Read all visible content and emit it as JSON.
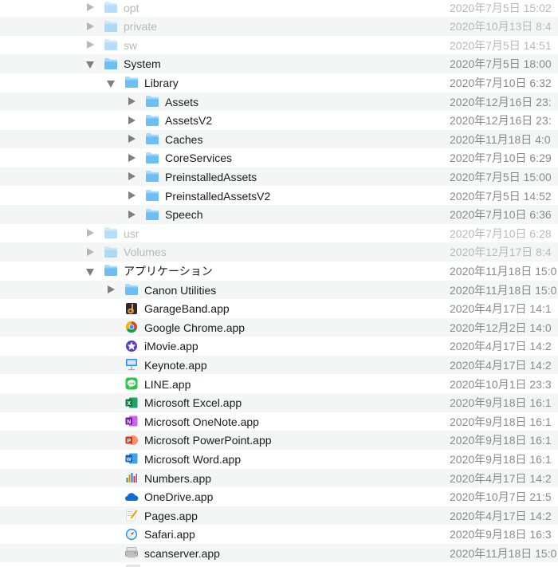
{
  "rows": [
    {
      "name": "opt",
      "date": "2020年7月5日 15:02",
      "level": 0,
      "disclosure": "closed",
      "icon": "folder-icon",
      "dim": true
    },
    {
      "name": "private",
      "date": "2020年10月13日 8:4",
      "level": 0,
      "disclosure": "closed",
      "icon": "folder-icon",
      "dim": true
    },
    {
      "name": "sw",
      "date": "2020年7月5日 14:51",
      "level": 0,
      "disclosure": "closed",
      "icon": "folder-icon",
      "dim": true
    },
    {
      "name": "System",
      "date": "2020年7月5日 18:00",
      "level": 0,
      "disclosure": "open",
      "icon": "folder-icon",
      "dim": false
    },
    {
      "name": "Library",
      "date": "2020年7月10日 6:32",
      "level": 1,
      "disclosure": "open",
      "icon": "folder-icon",
      "dim": false
    },
    {
      "name": "Assets",
      "date": "2020年12月16日 23:",
      "level": 2,
      "disclosure": "closed",
      "icon": "folder-icon",
      "dim": false
    },
    {
      "name": "AssetsV2",
      "date": "2020年12月16日 23:",
      "level": 2,
      "disclosure": "closed",
      "icon": "folder-icon",
      "dim": false
    },
    {
      "name": "Caches",
      "date": "2020年11月18日 4:0",
      "level": 2,
      "disclosure": "closed",
      "icon": "folder-icon",
      "dim": false
    },
    {
      "name": "CoreServices",
      "date": "2020年7月10日 6:29",
      "level": 2,
      "disclosure": "closed",
      "icon": "folder-icon",
      "dim": false
    },
    {
      "name": "PreinstalledAssets",
      "date": "2020年7月5日 15:00",
      "level": 2,
      "disclosure": "closed",
      "icon": "folder-icon",
      "dim": false
    },
    {
      "name": "PreinstalledAssetsV2",
      "date": "2020年7月5日 14:52",
      "level": 2,
      "disclosure": "closed",
      "icon": "folder-icon",
      "dim": false
    },
    {
      "name": "Speech",
      "date": "2020年7月10日 6:36",
      "level": 2,
      "disclosure": "closed",
      "icon": "folder-icon",
      "dim": false
    },
    {
      "name": "usr",
      "date": "2020年7月10日 6:28",
      "level": 0,
      "disclosure": "closed",
      "icon": "folder-icon",
      "dim": true
    },
    {
      "name": "Volumes",
      "date": "2020年12月17日 8:4",
      "level": 0,
      "disclosure": "closed",
      "icon": "folder-icon",
      "dim": true
    },
    {
      "name": "アプリケーション",
      "date": "2020年11月18日 15:0",
      "level": 0,
      "disclosure": "open",
      "icon": "folder-icon",
      "dim": false
    },
    {
      "name": "Canon Utilities",
      "date": "2020年11月18日 15:0",
      "level": 1,
      "disclosure": "closed",
      "icon": "folder-icon",
      "dim": false
    },
    {
      "name": "GarageBand.app",
      "date": "2020年4月17日 14:1",
      "level": 1,
      "disclosure": "none",
      "icon": "garageband-icon",
      "dim": false
    },
    {
      "name": "Google Chrome.app",
      "date": "2020年12月2日 14:0",
      "level": 1,
      "disclosure": "none",
      "icon": "chrome-icon",
      "dim": false
    },
    {
      "name": "iMovie.app",
      "date": "2020年4月17日 14:2",
      "level": 1,
      "disclosure": "none",
      "icon": "imovie-icon",
      "dim": false
    },
    {
      "name": "Keynote.app",
      "date": "2020年4月17日 14:2",
      "level": 1,
      "disclosure": "none",
      "icon": "keynote-icon",
      "dim": false
    },
    {
      "name": "LINE.app",
      "date": "2020年10月1日 23:3",
      "level": 1,
      "disclosure": "none",
      "icon": "line-icon",
      "dim": false
    },
    {
      "name": "Microsoft Excel.app",
      "date": "2020年9月18日 16:1",
      "level": 1,
      "disclosure": "none",
      "icon": "excel-icon",
      "dim": false
    },
    {
      "name": "Microsoft OneNote.app",
      "date": "2020年9月18日 16:1",
      "level": 1,
      "disclosure": "none",
      "icon": "onenote-icon",
      "dim": false
    },
    {
      "name": "Microsoft PowerPoint.app",
      "date": "2020年9月18日 16:1",
      "level": 1,
      "disclosure": "none",
      "icon": "powerpoint-icon",
      "dim": false
    },
    {
      "name": "Microsoft Word.app",
      "date": "2020年9月18日 16:1",
      "level": 1,
      "disclosure": "none",
      "icon": "word-icon",
      "dim": false
    },
    {
      "name": "Numbers.app",
      "date": "2020年4月17日 14:2",
      "level": 1,
      "disclosure": "none",
      "icon": "numbers-icon",
      "dim": false
    },
    {
      "name": "OneDrive.app",
      "date": "2020年10月7日 21:5",
      "level": 1,
      "disclosure": "none",
      "icon": "onedrive-icon",
      "dim": false
    },
    {
      "name": "Pages.app",
      "date": "2020年4月17日 14:2",
      "level": 1,
      "disclosure": "none",
      "icon": "pages-icon",
      "dim": false
    },
    {
      "name": "Safari.app",
      "date": "2020年9月18日 16:3",
      "level": 1,
      "disclosure": "none",
      "icon": "safari-icon",
      "dim": false
    },
    {
      "name": "scanserver.app",
      "date": "2020年11月18日 15:0",
      "level": 1,
      "disclosure": "none",
      "icon": "scanner-icon",
      "dim": false
    }
  ],
  "colors": {
    "folder_top": "#a9daf9",
    "folder_body": "#6bbff4",
    "row_stripe": "#f4f5f5",
    "triangle": "#7f7f7f",
    "date_text": "#8a8a8a"
  }
}
